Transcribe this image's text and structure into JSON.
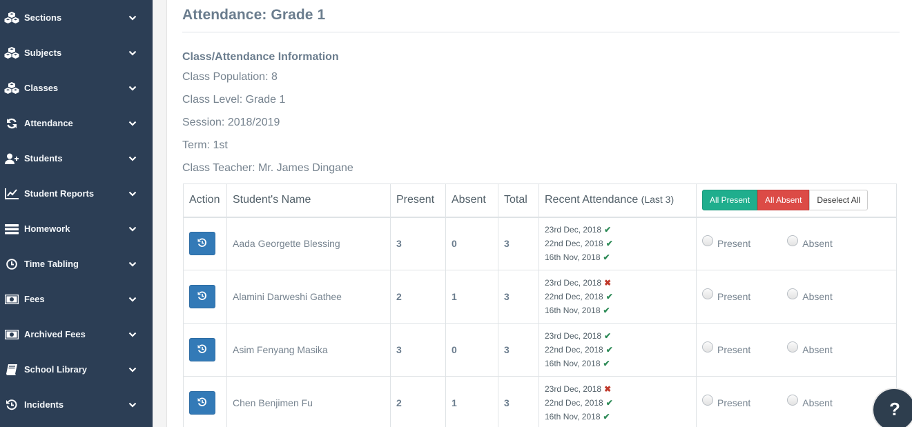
{
  "sidebar": {
    "items": [
      {
        "label": "Sections",
        "icon": "cubes-icon"
      },
      {
        "label": "Subjects",
        "icon": "cubes-icon"
      },
      {
        "label": "Classes",
        "icon": "cubes-icon"
      },
      {
        "label": "Attendance",
        "icon": "refresh-icon"
      },
      {
        "label": "Students",
        "icon": "user-plus-icon"
      },
      {
        "label": "Student Reports",
        "icon": "line-chart-icon"
      },
      {
        "label": "Homework",
        "icon": "list-icon"
      },
      {
        "label": "Time Tabling",
        "icon": "clock-icon"
      },
      {
        "label": "Fees",
        "icon": "money-icon"
      },
      {
        "label": "Archived Fees",
        "icon": "money-icon"
      },
      {
        "label": "School Library",
        "icon": "book-icon"
      },
      {
        "label": "Incidents",
        "icon": "history-icon"
      }
    ]
  },
  "page": {
    "title": "Attendance: Grade 1",
    "info_heading": "Class/Attendance Information",
    "info": {
      "population": "Class Population: 8",
      "level": "Class Level: Grade 1",
      "session": "Session: 2018/2019",
      "term": "Term: 1st",
      "teacher": "Class Teacher: Mr. James Dingane"
    }
  },
  "table": {
    "headers": {
      "action": "Action",
      "name": "Student's Name",
      "present": "Present",
      "absent": "Absent",
      "total": "Total",
      "recent": "Recent Attendance",
      "recent_note": "(Last 3)"
    },
    "bulk_buttons": {
      "all_present": "All Present",
      "all_absent": "All Absent",
      "deselect": "Deselect All"
    },
    "radio_labels": {
      "present": "Present",
      "absent": "Absent"
    },
    "rows": [
      {
        "name": "Aada Georgette Blessing",
        "present": "3",
        "absent": "0",
        "total": "3",
        "recent": [
          {
            "date": "23rd Dec, 2018",
            "status": "present"
          },
          {
            "date": "22nd Dec, 2018",
            "status": "present"
          },
          {
            "date": "16th Nov, 2018",
            "status": "present"
          }
        ]
      },
      {
        "name": "Alamini Darweshi Gathee",
        "present": "2",
        "absent": "1",
        "total": "3",
        "recent": [
          {
            "date": "23rd Dec, 2018",
            "status": "absent"
          },
          {
            "date": "22nd Dec, 2018",
            "status": "present"
          },
          {
            "date": "16th Nov, 2018",
            "status": "present"
          }
        ]
      },
      {
        "name": "Asim Fenyang Masika",
        "present": "3",
        "absent": "0",
        "total": "3",
        "recent": [
          {
            "date": "23rd Dec, 2018",
            "status": "present"
          },
          {
            "date": "22nd Dec, 2018",
            "status": "present"
          },
          {
            "date": "16th Nov, 2018",
            "status": "present"
          }
        ]
      },
      {
        "name": "Chen Benjimen Fu",
        "present": "2",
        "absent": "1",
        "total": "3",
        "recent": [
          {
            "date": "23rd Dec, 2018",
            "status": "absent"
          },
          {
            "date": "22nd Dec, 2018",
            "status": "present"
          },
          {
            "date": "16th Nov, 2018",
            "status": "present"
          }
        ]
      }
    ]
  },
  "help": {
    "label": "?"
  },
  "colors": {
    "sidebar_bg": "#2c3e55",
    "all_present": "#1fae8d",
    "all_absent": "#dc4b46",
    "action_button": "#337ab7",
    "check": "#2e8b57",
    "cross": "#c0392b"
  }
}
